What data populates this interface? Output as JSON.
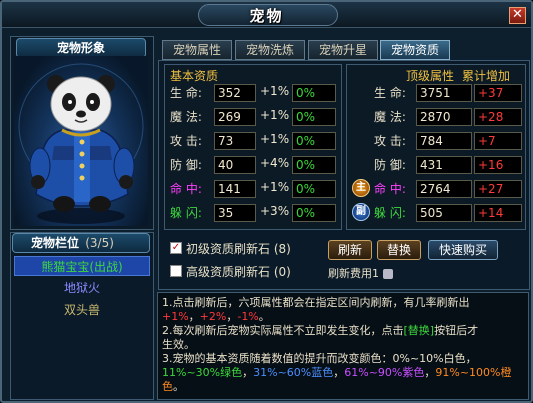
{
  "window": {
    "title": "宠物",
    "close": "✕"
  },
  "pet_image_header": "宠物形象",
  "pet_list": {
    "header": "宠物栏位",
    "count": "(3/5)",
    "items": [
      {
        "name": "熊猫宝宝(出战)",
        "color": "#3cd83c"
      },
      {
        "name": "地狱火",
        "color": "#8a8aff"
      },
      {
        "name": "双头兽",
        "color": "#c8b870"
      }
    ]
  },
  "tabs": [
    "宠物属性",
    "宠物洗炼",
    "宠物升星",
    "宠物资质"
  ],
  "basic": {
    "title": "基本资质",
    "rows": [
      {
        "label": "生  命:",
        "value": "352",
        "pct": "+1%",
        "bonus": "0%"
      },
      {
        "label": "魔  法:",
        "value": "269",
        "pct": "+1%",
        "bonus": "0%"
      },
      {
        "label": "攻  击:",
        "value": "73",
        "pct": "+1%",
        "bonus": "0%"
      },
      {
        "label": "防  御:",
        "value": "40",
        "pct": "+4%",
        "bonus": "0%"
      },
      {
        "label": "命  中:",
        "value": "141",
        "pct": "+1%",
        "bonus": "0%"
      },
      {
        "label": "躲  闪:",
        "value": "35",
        "pct": "+3%",
        "bonus": "0%"
      }
    ]
  },
  "top": {
    "title": "顶级属性",
    "title2": "累计增加",
    "rows": [
      {
        "label": "生  命:",
        "value": "3751",
        "add": "+37"
      },
      {
        "label": "魔  法:",
        "value": "2870",
        "add": "+28"
      },
      {
        "label": "攻  击:",
        "value": "784",
        "add": "+7"
      },
      {
        "label": "防  御:",
        "value": "431",
        "add": "+16"
      },
      {
        "label": "命  中:",
        "value": "2764",
        "add": "+27"
      },
      {
        "label": "躲  闪:",
        "value": "505",
        "add": "+14"
      }
    ],
    "badge_main": "主",
    "badge_sub": "副"
  },
  "stones": {
    "primary": "初级资质刷新石 (8)",
    "advanced": "高级资质刷新石 (0)",
    "check": "✓"
  },
  "buttons": {
    "refresh": "刷新",
    "replace": "替换",
    "buy": "快速购买"
  },
  "refresh_cost": "刷新费用1",
  "desc": {
    "l1": "1.点击刷新后，六项属性都会在指定区间内刷新，有几率刷新出",
    "l2a": "+1%",
    "l2b": "，",
    "l2c": "+2%",
    "l2d": "，",
    "l2e": "-1%",
    "l2f": "。",
    "l3a": "2.每次刷新后宠物实际属性不立即发生变化，点击",
    "l3b": "[替换]",
    "l3c": "按钮后才",
    "l4": "生效。",
    "l5": "3.宠物的基本资质随着数值的提升而改变颜色：0%~10%白色，",
    "l6a": "11%~30%绿色",
    "l6b": "，",
    "l6c": "31%~60%蓝色",
    "l6d": "，",
    "l6e": "61%~90%紫色",
    "l6f": "，",
    "l6g": "91%~100%橙色",
    "l6h": "。"
  }
}
